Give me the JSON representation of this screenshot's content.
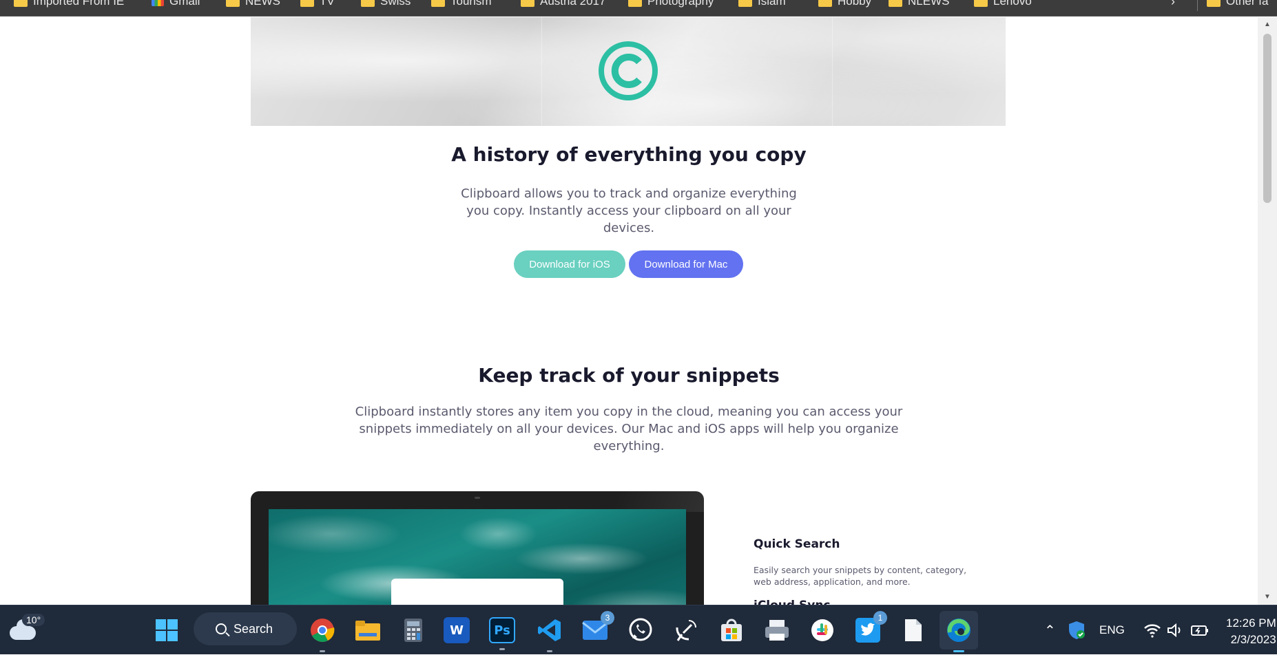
{
  "bookmarks": {
    "items": [
      {
        "label": "Imported From IE",
        "icon": "folder-icon"
      },
      {
        "label": "Gmail",
        "icon": "gmail-icon"
      },
      {
        "label": "NEWS",
        "icon": "folder-icon"
      },
      {
        "label": "TV",
        "icon": "folder-icon"
      },
      {
        "label": "Swiss",
        "icon": "folder-icon"
      },
      {
        "label": "Tourism",
        "icon": "folder-icon"
      },
      {
        "label": "Austria 2017",
        "icon": "folder-icon"
      },
      {
        "label": "Photography",
        "icon": "folder-icon"
      },
      {
        "label": "Islam",
        "icon": "folder-icon"
      },
      {
        "label": "Hobby",
        "icon": "folder-icon"
      },
      {
        "label": "NLEWS",
        "icon": "folder-icon"
      },
      {
        "label": "Lenovo",
        "icon": "folder-icon"
      }
    ],
    "other_label": "Other fa",
    "overflow_icon": "chevron-right-icon"
  },
  "hero": {
    "logo_icon": "copyright-logo-icon",
    "title": "A history of everything you copy",
    "description_lines": [
      "Clipboard allows you to track and organize everything",
      "you copy. Instantly access your clipboard on all your",
      "devices."
    ],
    "buttons": {
      "ios": "Download for iOS",
      "mac": "Download for Mac"
    }
  },
  "snippets": {
    "title": "Keep track of your snippets",
    "description_lines": [
      "Clipboard instantly stores any item you copy in the cloud, meaning you can access your",
      "snippets immediately on all your devices. Our Mac and iOS apps will help you organize",
      "everything."
    ]
  },
  "features": {
    "quick_search": {
      "title": "Quick Search",
      "description_lines": [
        "Easily search your snippets by content, category,",
        "web address, application, and more."
      ]
    },
    "next_title_partial": "iCloud Sync"
  },
  "colors": {
    "teal": "#6ad0c0",
    "indigo": "#6272f0",
    "logo": "#2cbfa3",
    "heading": "#1a1a2e",
    "body_text": "#5a5a6e",
    "taskbar": "#1f2a3a"
  },
  "taskbar": {
    "weather": {
      "temp": "10°",
      "icon": "cloud-weather-icon"
    },
    "search_label": "Search",
    "apps": [
      {
        "name": "windows-start-icon"
      },
      {
        "name": "chrome-icon"
      },
      {
        "name": "file-explorer-icon"
      },
      {
        "name": "calculator-icon"
      },
      {
        "name": "word-icon",
        "text": "W"
      },
      {
        "name": "photoshop-icon",
        "text": "Ps"
      },
      {
        "name": "vscode-icon"
      },
      {
        "name": "mail-icon",
        "badge": "3"
      },
      {
        "name": "whatsapp-icon"
      },
      {
        "name": "satellite-icon"
      },
      {
        "name": "store-icon"
      },
      {
        "name": "printer-icon"
      },
      {
        "name": "slack-icon"
      },
      {
        "name": "twitter-icon",
        "badge": "1"
      },
      {
        "name": "notepad-icon"
      },
      {
        "name": "edge-icon"
      }
    ],
    "tray": {
      "language": "ENG",
      "time": "12:26 PM",
      "date": "2/3/2023"
    }
  }
}
